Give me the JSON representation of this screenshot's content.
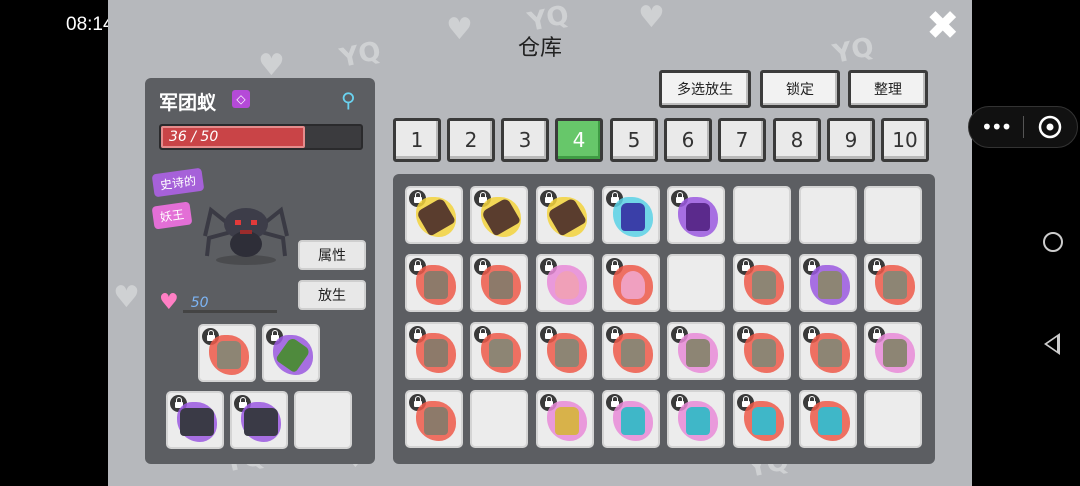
{
  "status": {
    "time": "08:14",
    "battery": "100"
  },
  "game": {
    "title": "仓库",
    "close_icon": "close-icon",
    "watermark_text": "YQ",
    "monster": {
      "name": "军团蚁",
      "hp_text": "36 / 50",
      "hp_fraction": 0.72,
      "tags": [
        "史诗的",
        "妖王"
      ],
      "love_value": "50",
      "buttons": {
        "attributes": "属性",
        "release": "放生"
      }
    },
    "actions": {
      "multi_release": "多选放生",
      "lock": "锁定",
      "sort": "整理"
    },
    "tabs": [
      "1",
      "2",
      "3",
      "4",
      "5",
      "6",
      "7",
      "8",
      "9",
      "10"
    ],
    "active_tab": "4",
    "colors": {
      "active_tab": "#67c76a",
      "hp_bar": "#c94447",
      "panel": "#5c5e62"
    }
  }
}
